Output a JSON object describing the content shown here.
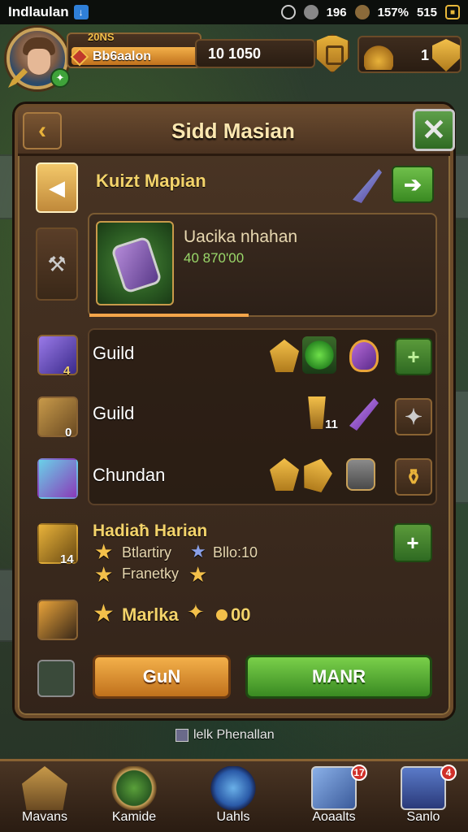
{
  "status_bar": {
    "app_name": "Indlaulan",
    "indicator_1": "196",
    "indicator_2": "157%",
    "time": "515"
  },
  "hud": {
    "xp_tag": "20NS",
    "xp_text": "Bb6aalon",
    "gold": "10 1050",
    "bell_count": "1"
  },
  "window": {
    "title": "Sidd Masian",
    "section_title": "Kuizt Mapian",
    "featured": {
      "name": "Uacika nhahan",
      "value": "40 870'00"
    },
    "rows": [
      {
        "label": "Guild",
        "badge": "4"
      },
      {
        "label": "Guild",
        "badge": "0",
        "count": "11"
      },
      {
        "label": "Chundan"
      }
    ],
    "reward": {
      "title": "Hadiaħ Harian",
      "line1_a": "Btlartiry",
      "line1_b": "Bllo:10",
      "line2": "Franetky",
      "main_label": "Marlka",
      "main_value": "00",
      "left_count": "14"
    },
    "buttons": {
      "secondary": "GuN",
      "primary": "MANR"
    }
  },
  "footer_note": "lelk Phenallan",
  "bottom_nav": [
    {
      "label": "Mavans"
    },
    {
      "label": "Kamide"
    },
    {
      "label": "Uahls"
    },
    {
      "label": "Aoaalts",
      "badge": "17"
    },
    {
      "label": "Sanlo",
      "badge": "4"
    }
  ],
  "colors": {
    "accent_gold": "#f3c04a",
    "primary_green": "#3a8a22",
    "panel_brown": "#4a3524"
  }
}
